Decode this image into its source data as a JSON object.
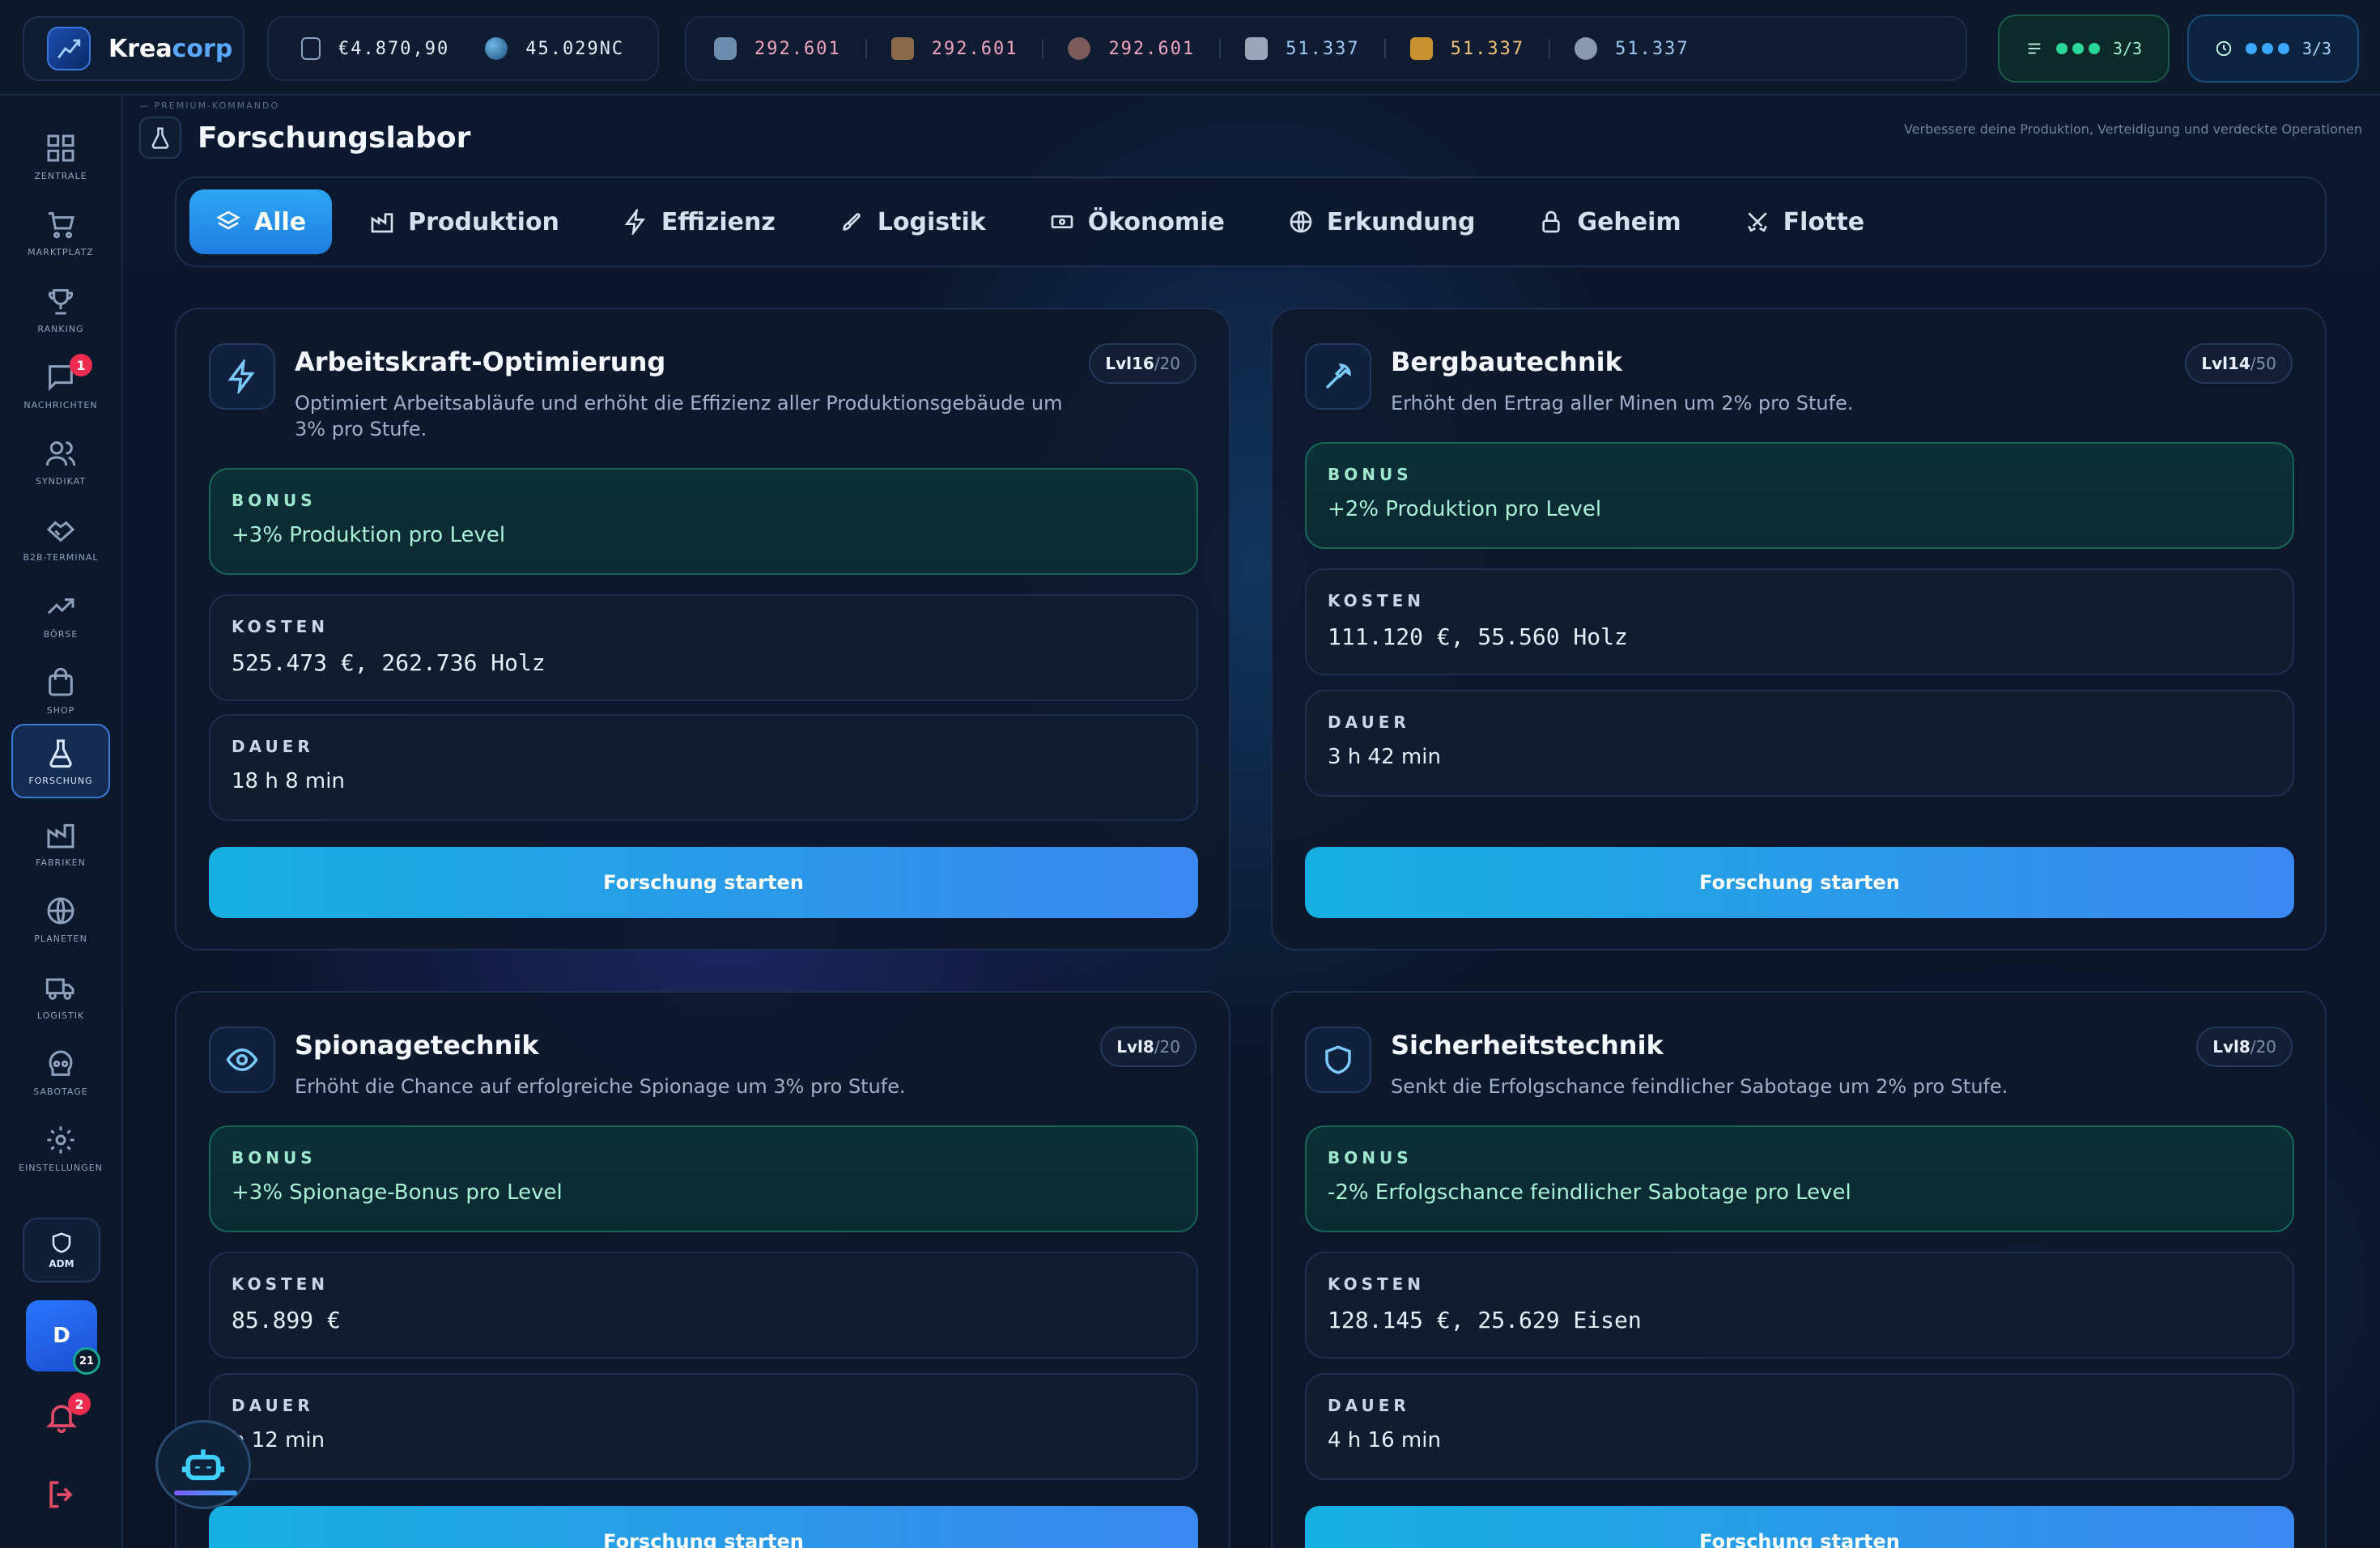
{
  "topbar": {
    "logo": {
      "name_a": "Krea",
      "name_b": "corp"
    },
    "money": [
      {
        "icon": "euro-icon",
        "value": "€4.870,90"
      },
      {
        "icon": "planet-coin-icon",
        "value": "45.029NC"
      }
    ],
    "resources": [
      {
        "icon": "ore-icon",
        "value": "292.601"
      },
      {
        "icon": "wood-icon",
        "value": "292.601"
      },
      {
        "icon": "rock-icon",
        "value": "292.601"
      },
      {
        "icon": "metal-icon",
        "value": "51.337"
      },
      {
        "icon": "gold-icon",
        "value": "51.337"
      },
      {
        "icon": "stone-icon",
        "value": "51.337"
      }
    ],
    "queue_status": {
      "value": "3/3",
      "color": "#28d79a"
    },
    "timer_status": {
      "value": "3/3",
      "color": "#3aa8ff"
    }
  },
  "sidebar": {
    "items": [
      {
        "label": "Zentrale",
        "icon": "dashboard-icon"
      },
      {
        "label": "Marktplatz",
        "icon": "cart-icon"
      },
      {
        "label": "Ranking",
        "icon": "trophy-icon"
      },
      {
        "label": "Nachrichten",
        "icon": "message-icon",
        "badge": "1"
      },
      {
        "label": "Syndikat",
        "icon": "users-icon"
      },
      {
        "label": "B2B-Terminal",
        "icon": "handshake-icon"
      },
      {
        "label": "Börse",
        "icon": "trend-icon"
      },
      {
        "label": "Shop",
        "icon": "bag-icon"
      },
      {
        "label": "Forschung",
        "icon": "flask-icon",
        "active": true
      },
      {
        "label": "Fabriken",
        "icon": "factory-icon"
      },
      {
        "label": "Planeten",
        "icon": "globe-icon"
      },
      {
        "label": "Logistik",
        "icon": "truck-icon"
      },
      {
        "label": "Sabotage",
        "icon": "skull-icon"
      },
      {
        "label": "Einstellungen",
        "icon": "gear-icon"
      }
    ],
    "admin_label": "ADM",
    "user_initial": "D",
    "user_level": "21",
    "notification_badge": "2"
  },
  "header": {
    "breadcrumb": "— PREMIUM-KOMMANDO",
    "title": "Forschungslabor",
    "subtitle": "Verbessere deine Produktion, Verteidigung und verdeckte Operationen"
  },
  "tabs": [
    {
      "label": "Alle",
      "icon": "layers-icon"
    },
    {
      "label": "Produktion",
      "icon": "factory-icon"
    },
    {
      "label": "Effizienz",
      "icon": "bolt-icon"
    },
    {
      "label": "Logistik",
      "icon": "rocket-icon"
    },
    {
      "label": "Ökonomie",
      "icon": "banknote-icon"
    },
    {
      "label": "Erkundung",
      "icon": "globe-icon"
    },
    {
      "label": "Geheim",
      "icon": "lock-icon"
    },
    {
      "label": "Flotte",
      "icon": "swords-icon"
    }
  ],
  "labels": {
    "bonus": "BONUS",
    "cost": "KOSTEN",
    "duration": "DAUER",
    "start": "Forschung starten"
  },
  "cards": [
    {
      "title": "Arbeitskraft-Optimierung",
      "icon": "bolt-icon",
      "level_prefix": "Lvl ",
      "level": "16",
      "level_max": "/20",
      "description": "Optimiert Arbeitsabläufe und erhöht die Effizienz aller Produktionsgebäude um 3% pro Stufe.",
      "bonus": "+3% Produktion pro Level",
      "cost": "525.473 €, 262.736 Holz",
      "duration": "18 h 8 min"
    },
    {
      "title": "Bergbautechnik",
      "icon": "pickaxe-icon",
      "level_prefix": "Lvl ",
      "level": "14",
      "level_max": "/50",
      "description": "Erhöht den Ertrag aller Minen um 2% pro Stufe.",
      "bonus": "+2% Produktion pro Level",
      "cost": "111.120 €, 55.560 Holz",
      "duration": "3 h 42 min"
    },
    {
      "title": "Spionagetechnik",
      "icon": "eye-icon",
      "level_prefix": "Lvl ",
      "level": "8",
      "level_max": "/20",
      "description": "Erhöht die Chance auf erfolgreiche Spionage um 3% pro Stufe.",
      "bonus": "+3% Spionage-Bonus pro Level",
      "cost": "85.899 €",
      "duration": "h 12 min"
    },
    {
      "title": "Sicherheitstechnik",
      "icon": "shield-icon",
      "level_prefix": "Lvl ",
      "level": "8",
      "level_max": "/20",
      "description": "Senkt die Erfolgschance feindlicher Sabotage um 2% pro Stufe.",
      "bonus": "-2% Erfolgschance feindlicher Sabotage pro Level",
      "cost": "128.145 €, 25.629 Eisen",
      "duration": "4 h 16 min"
    }
  ]
}
